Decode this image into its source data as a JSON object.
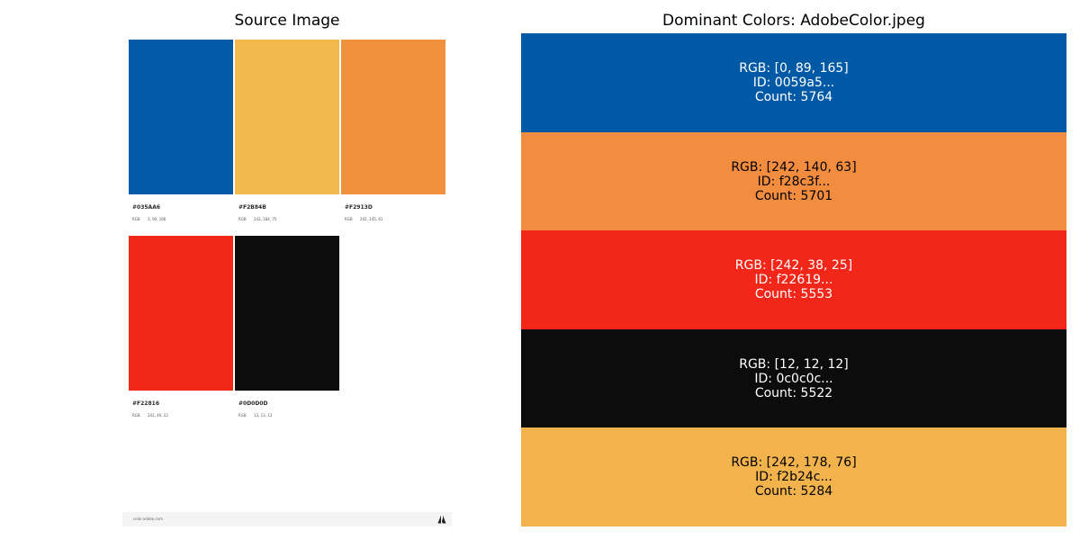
{
  "left_panel": {
    "title": "Source Image",
    "swatches": [
      {
        "hex": "#035AA6",
        "rgb_label": "RGB",
        "rgb_value": "3, 90, 166",
        "color": "#035AA6"
      },
      {
        "hex": "#F2B84B",
        "rgb_label": "RGB",
        "rgb_value": "242, 184, 75",
        "color": "#F2B84B"
      },
      {
        "hex": "#F2913D",
        "rgb_label": "RGB",
        "rgb_value": "242, 145, 61",
        "color": "#F2913D"
      },
      {
        "hex": "#F22816",
        "rgb_label": "RGB",
        "rgb_value": "242, 40, 22",
        "color": "#F22816"
      },
      {
        "hex": "#0D0D0D",
        "rgb_label": "RGB",
        "rgb_value": "13, 13, 13",
        "color": "#0D0D0D"
      }
    ],
    "footer": {
      "url": "color.adobe.com",
      "logo_icon": "adobe-logo-icon"
    }
  },
  "right_panel": {
    "title": "Dominant Colors: AdobeColor.jpeg",
    "colors": [
      {
        "rgb": "RGB: [0, 89, 165]",
        "id": "ID: 0059a5...",
        "count": "Count: 5764",
        "fill": "#0059A5",
        "text_color": "#ffffff"
      },
      {
        "rgb": "RGB: [242, 140, 63]",
        "id": "ID: f28c3f...",
        "count": "Count: 5701",
        "fill": "#F28C3F",
        "text_color": "#000000"
      },
      {
        "rgb": "RGB: [242, 38, 25]",
        "id": "ID: f22619...",
        "count": "Count: 5553",
        "fill": "#F22619",
        "text_color": "#ffffff"
      },
      {
        "rgb": "RGB: [12, 12, 12]",
        "id": "ID: 0c0c0c...",
        "count": "Count: 5522",
        "fill": "#0C0C0C",
        "text_color": "#ffffff"
      },
      {
        "rgb": "RGB: [242, 178, 76]",
        "id": "ID: f2b24c...",
        "count": "Count: 5284",
        "fill": "#F2B24C",
        "text_color": "#000000"
      }
    ]
  }
}
